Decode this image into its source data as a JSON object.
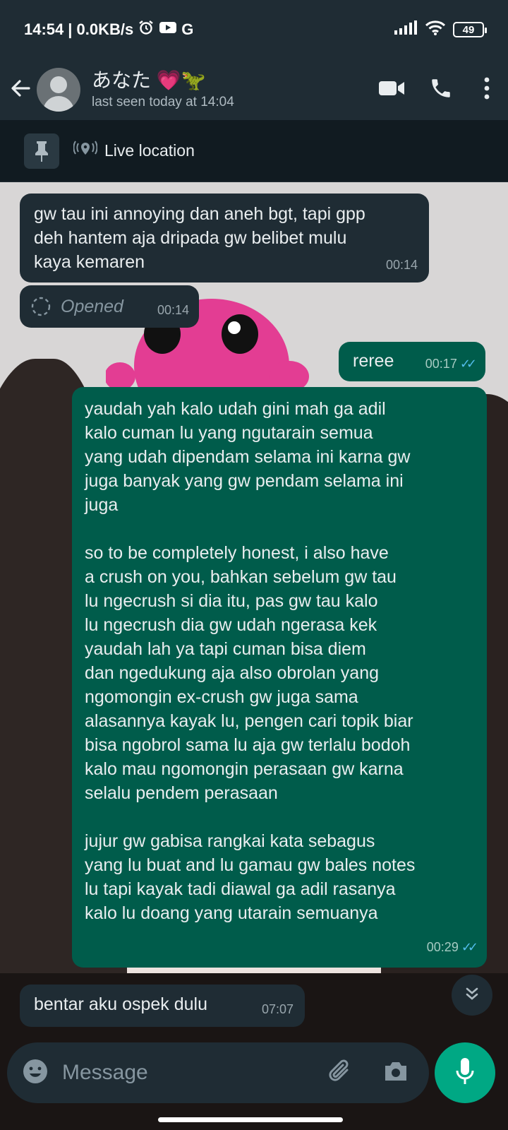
{
  "status_bar": {
    "time": "14:54",
    "speed": "| 0.0KB/s",
    "g_label": "G",
    "battery": "49"
  },
  "header": {
    "contact_name": "あなた 💗🦖",
    "last_seen": "last seen today at 14:04"
  },
  "pinned": {
    "label": "Live location"
  },
  "messages": [
    {
      "direction": "in",
      "text": "gw tau ini annoying dan aneh bgt, tapi gpp\ndeh hantem aja dripada gw belibet mulu\nkaya kemaren",
      "time": "00:14"
    },
    {
      "direction": "in",
      "type": "view-once",
      "text": "Opened",
      "time": "00:14"
    },
    {
      "direction": "out",
      "text": "reree",
      "time": "00:17",
      "status": "read"
    },
    {
      "direction": "out",
      "text": "yaudah yah kalo udah gini mah ga adil\nkalo cuman lu yang ngutarain semua\nyang udah dipendam selama ini karna gw\njuga banyak yang gw pendam selama ini\njuga\n\nso to be completely honest, i also have\na crush on you, bahkan sebelum gw tau\nlu ngecrush si dia itu, pas gw tau kalo\nlu ngecrush dia gw udah ngerasa kek\nyaudah lah ya tapi cuman bisa diem\ndan ngedukung aja also obrolan yang\nngomongin ex-crush gw juga sama\nalasannya kayak lu, pengen cari topik biar\nbisa ngobrol sama lu aja gw terlalu bodoh\nkalo mau ngomongin perasaan gw karna\nselalu pendem perasaan\n\njujur gw gabisa rangkai kata sebagus\nyang lu buat and lu gamau gw bales notes\nlu tapi kayak tadi diawal ga adil rasanya\nkalo lu doang yang utarain semuanya",
      "time": "00:29",
      "status": "read"
    },
    {
      "direction": "in",
      "text": "bentar aku ospek dulu",
      "time": "07:07"
    }
  ],
  "input": {
    "placeholder": "Message"
  },
  "colors": {
    "header_bg": "#1f2c34",
    "incoming_bubble": "#1f2c34",
    "outgoing_bubble": "#005c4b",
    "accent": "#00a884",
    "read_ticks": "#53bdeb"
  },
  "icons": [
    "alarm-icon",
    "youtube-icon",
    "signal-icon",
    "wifi-icon",
    "battery-icon",
    "back-arrow-icon",
    "video-call-icon",
    "voice-call-icon",
    "more-options-icon",
    "pin-icon",
    "live-location-icon",
    "view-once-icon",
    "chevron-down-icon",
    "emoji-icon",
    "attach-icon",
    "camera-icon",
    "mic-icon"
  ]
}
